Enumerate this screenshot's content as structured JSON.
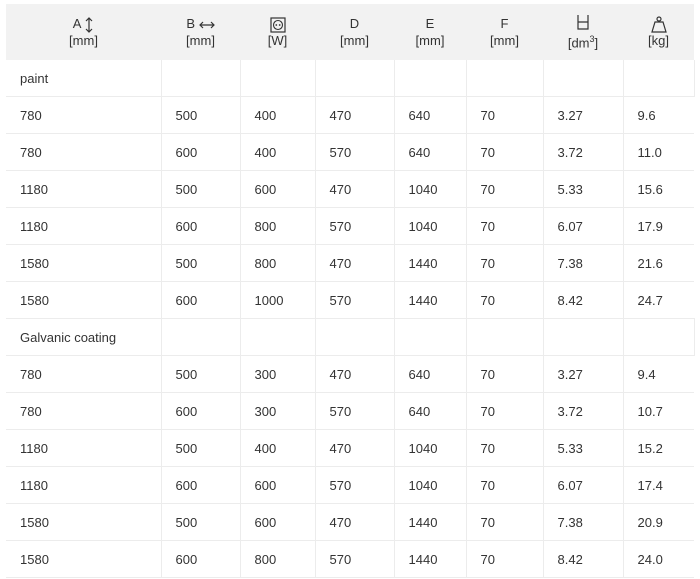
{
  "headers": [
    {
      "top": "A",
      "unit": "[mm]",
      "icon": "vertical-arrow-icon"
    },
    {
      "top": "B",
      "unit": "[mm]",
      "icon": "horizontal-arrow-icon"
    },
    {
      "top": "",
      "unit": "[W]",
      "icon": "power-socket-icon"
    },
    {
      "top": "D",
      "unit": "[mm]",
      "icon": ""
    },
    {
      "top": "E",
      "unit": "[mm]",
      "icon": ""
    },
    {
      "top": "F",
      "unit": "[mm]",
      "icon": ""
    },
    {
      "top": "",
      "unit": "[dm",
      "unit_sup": "3",
      "unit_end": "]",
      "icon": "container-icon"
    },
    {
      "top": "",
      "unit": "[kg]",
      "icon": "weight-icon"
    }
  ],
  "groups": [
    {
      "label": "paint",
      "rows": [
        [
          "780",
          "500",
          "400",
          "470",
          "640",
          "70",
          "3.27",
          "9.6"
        ],
        [
          "780",
          "600",
          "400",
          "570",
          "640",
          "70",
          "3.72",
          "11.0"
        ],
        [
          "1180",
          "500",
          "600",
          "470",
          "1040",
          "70",
          "5.33",
          "15.6"
        ],
        [
          "1180",
          "600",
          "800",
          "570",
          "1040",
          "70",
          "6.07",
          "17.9"
        ],
        [
          "1580",
          "500",
          "800",
          "470",
          "1440",
          "70",
          "7.38",
          "21.6"
        ],
        [
          "1580",
          "600",
          "1000",
          "570",
          "1440",
          "70",
          "8.42",
          "24.7"
        ]
      ]
    },
    {
      "label": "Galvanic coating",
      "rows": [
        [
          "780",
          "500",
          "300",
          "470",
          "640",
          "70",
          "3.27",
          "9.4"
        ],
        [
          "780",
          "600",
          "300",
          "570",
          "640",
          "70",
          "3.72",
          "10.7"
        ],
        [
          "1180",
          "500",
          "400",
          "470",
          "1040",
          "70",
          "5.33",
          "15.2"
        ],
        [
          "1180",
          "600",
          "600",
          "570",
          "1040",
          "70",
          "6.07",
          "17.4"
        ],
        [
          "1580",
          "500",
          "600",
          "470",
          "1440",
          "70",
          "7.38",
          "20.9"
        ],
        [
          "1580",
          "600",
          "800",
          "570",
          "1440",
          "70",
          "8.42",
          "24.0"
        ]
      ]
    }
  ]
}
